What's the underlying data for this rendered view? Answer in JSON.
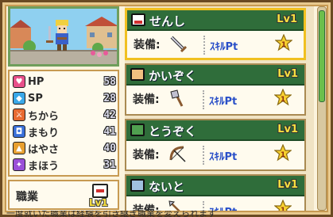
{
  "stats": [
    {
      "label": "HP",
      "value": "58",
      "icon": "heart-icon",
      "color": "#e8508a"
    },
    {
      "label": "SP",
      "value": "28",
      "icon": "diamond-icon",
      "color": "#3aa8e8"
    },
    {
      "label": "ちから",
      "value": "42",
      "icon": "sword-icon",
      "color": "#e86a30"
    },
    {
      "label": "まもり",
      "value": "41",
      "icon": "shield-icon",
      "color": "#3a70d8"
    },
    {
      "label": "はやさ",
      "value": "40",
      "icon": "boot-icon",
      "color": "#e8a030"
    },
    {
      "label": "まほう",
      "value": "31",
      "icon": "magic-icon",
      "color": "#9a50d8"
    }
  ],
  "job_box": {
    "label": "職業",
    "level": "Lv1"
  },
  "jobs": [
    {
      "name": "せんし",
      "level": "Lv1",
      "equip_label": "装備:",
      "skill_label": "ｽｷﾙPt",
      "equip_icon": "sword-icon",
      "selected": true
    },
    {
      "name": "かいぞく",
      "level": "Lv1",
      "equip_label": "装備:",
      "skill_label": "ｽｷﾙPt",
      "equip_icon": "axe-icon",
      "selected": false
    },
    {
      "name": "とうぞく",
      "level": "Lv1",
      "equip_label": "装備:",
      "skill_label": "ｽｷﾙPt",
      "equip_icon": "bow-icon",
      "selected": false
    },
    {
      "name": "ないと",
      "level": "Lv1",
      "equip_label": "装備:",
      "skill_label": "ｽｷﾙPt",
      "equip_icon": "spear-icon",
      "selected": false
    }
  ],
  "message": "一度就いた職業は経験を引き継ぎ職業を変えられます",
  "colors": {
    "header_green": "#2f6d3a",
    "selected_border": "#f0c020",
    "skill_blue": "#2a50c8",
    "level_yellow": "#f8e040"
  }
}
